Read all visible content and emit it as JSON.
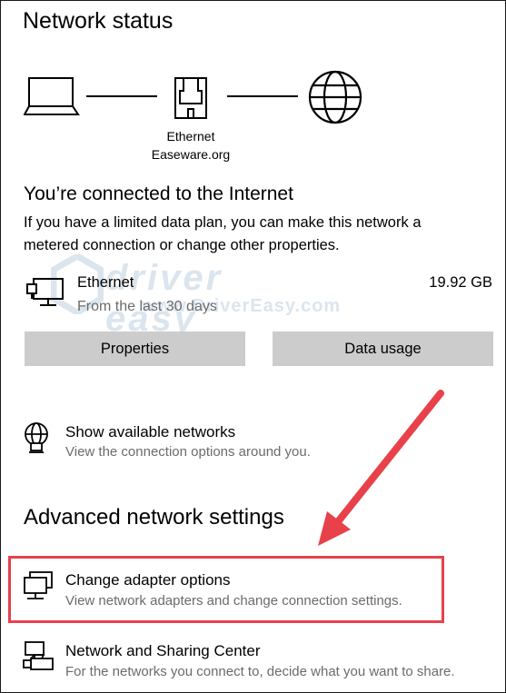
{
  "network_status": {
    "title": "Network status",
    "adapter_name": "Ethernet",
    "network_name": "Easeware.org"
  },
  "connection": {
    "heading": "You’re connected to the Internet",
    "description_line1": "If you have a limited data plan, you can make this network a",
    "description_line2": "metered connection or change other properties."
  },
  "usage": {
    "name": "Ethernet",
    "period": "From the last 30 days",
    "amount": "19.92 GB"
  },
  "buttons": {
    "properties": "Properties",
    "data_usage": "Data usage"
  },
  "show_networks": {
    "title": "Show available networks",
    "subtitle": "View the connection options around you."
  },
  "advanced": {
    "heading": "Advanced network settings",
    "change_adapter": {
      "title": "Change adapter options",
      "subtitle": "View network adapters and change connection settings."
    },
    "sharing_center": {
      "title": "Network and Sharing Center",
      "subtitle": "For the networks you connect to, decide what you want to share."
    }
  },
  "watermark": {
    "brand": "driver easy",
    "url": "www.DriverEasy.com"
  },
  "colors": {
    "highlight": "#e8414a",
    "button_bg": "#cccccc",
    "secondary_text": "#6b6b6b"
  }
}
